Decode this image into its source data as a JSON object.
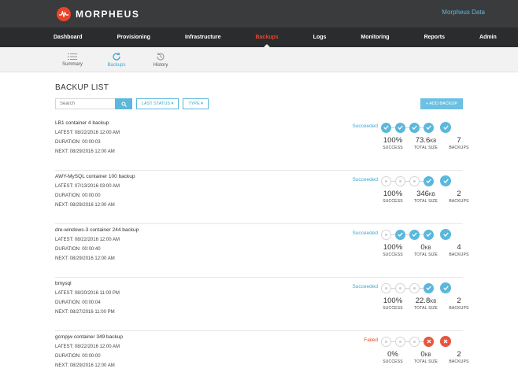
{
  "app": {
    "name": "MORPHEUS",
    "tenant": "Morpheus Data"
  },
  "nav": [
    {
      "label": "Dashboard",
      "active": false
    },
    {
      "label": "Provisioning",
      "active": false
    },
    {
      "label": "Infrastructure",
      "active": false
    },
    {
      "label": "Backups",
      "active": true
    },
    {
      "label": "Logs",
      "active": false
    },
    {
      "label": "Monitoring",
      "active": false
    },
    {
      "label": "Reports",
      "active": false
    },
    {
      "label": "Admin",
      "active": false
    }
  ],
  "subnav": [
    {
      "label": "Summary",
      "icon": "list-icon",
      "active": false
    },
    {
      "label": "Backups",
      "icon": "refresh-icon",
      "active": true
    },
    {
      "label": "History",
      "icon": "history-icon",
      "active": false
    }
  ],
  "page": {
    "title": "BACKUP LIST",
    "search_placeholder": "Search",
    "filter_status": "LAST STATUS",
    "filter_type": "TYPE",
    "add_button": "+ ADD BACKUP"
  },
  "labels": {
    "success": "SUCCESS",
    "total_size": "TOTAL SIZE",
    "backups": "BACKUPS"
  },
  "colors": {
    "accent": "#5bb8dc",
    "brand": "#e8452c",
    "topbar": "#3a3b3d",
    "navbar": "#2b2c2e"
  },
  "backups": [
    {
      "name": "LB1 container 4 backup",
      "latest": "LATEST: 08/22/2016 12:00 AM",
      "duration": "DURATION: 00:00:03",
      "next": "NEXT: 08/29/2016 12:00 AM",
      "status": "Succeeded",
      "history": [
        "success",
        "success",
        "success",
        "success"
      ],
      "last": "success",
      "success_pct": "100%",
      "size_num": "73.6",
      "size_unit": "KB",
      "count": "7"
    },
    {
      "name": "AWY-MySQL container 100 backup",
      "latest": "LATEST: 07/13/2016 03:00 AM",
      "duration": "DURATION: 00:00:00",
      "next": "NEXT: 08/29/2016 12:00 AM",
      "status": "Succeeded",
      "history": [
        "blank",
        "blank",
        "blank",
        "success"
      ],
      "last": "success",
      "success_pct": "100%",
      "size_num": "346",
      "size_unit": "KB",
      "count": "2"
    },
    {
      "name": "dre-windows-3 container 244 backup",
      "latest": "LATEST: 08/22/2016 12:00 AM",
      "duration": "DURATION: 00:00:40",
      "next": "NEXT: 08/29/2016 12:00 AM",
      "status": "Succeeded",
      "history": [
        "blank",
        "success",
        "success",
        "success"
      ],
      "last": "success",
      "success_pct": "100%",
      "size_num": "0",
      "size_unit": "KB",
      "count": "4"
    },
    {
      "name": "bmysql",
      "latest": "LATEST: 08/20/2016 11:00 PM",
      "duration": "DURATION: 00:00:04",
      "next": "NEXT: 08/27/2016 11:00 PM",
      "status": "Succeeded",
      "history": [
        "blank",
        "blank",
        "blank",
        "success"
      ],
      "last": "success",
      "success_pct": "100%",
      "size_num": "22.8",
      "size_unit": "KB",
      "count": "2"
    },
    {
      "name": "gcmpjw container 349 backup",
      "latest": "LATEST: 08/22/2016 12:00 AM",
      "duration": "DURATION: 00:00:00",
      "next": "NEXT: 08/29/2016 12:00 AM",
      "status": "Failed",
      "history": [
        "blank",
        "blank",
        "blank",
        "failed"
      ],
      "last": "failed",
      "success_pct": "0%",
      "size_num": "0",
      "size_unit": "KB",
      "count": "2"
    }
  ]
}
